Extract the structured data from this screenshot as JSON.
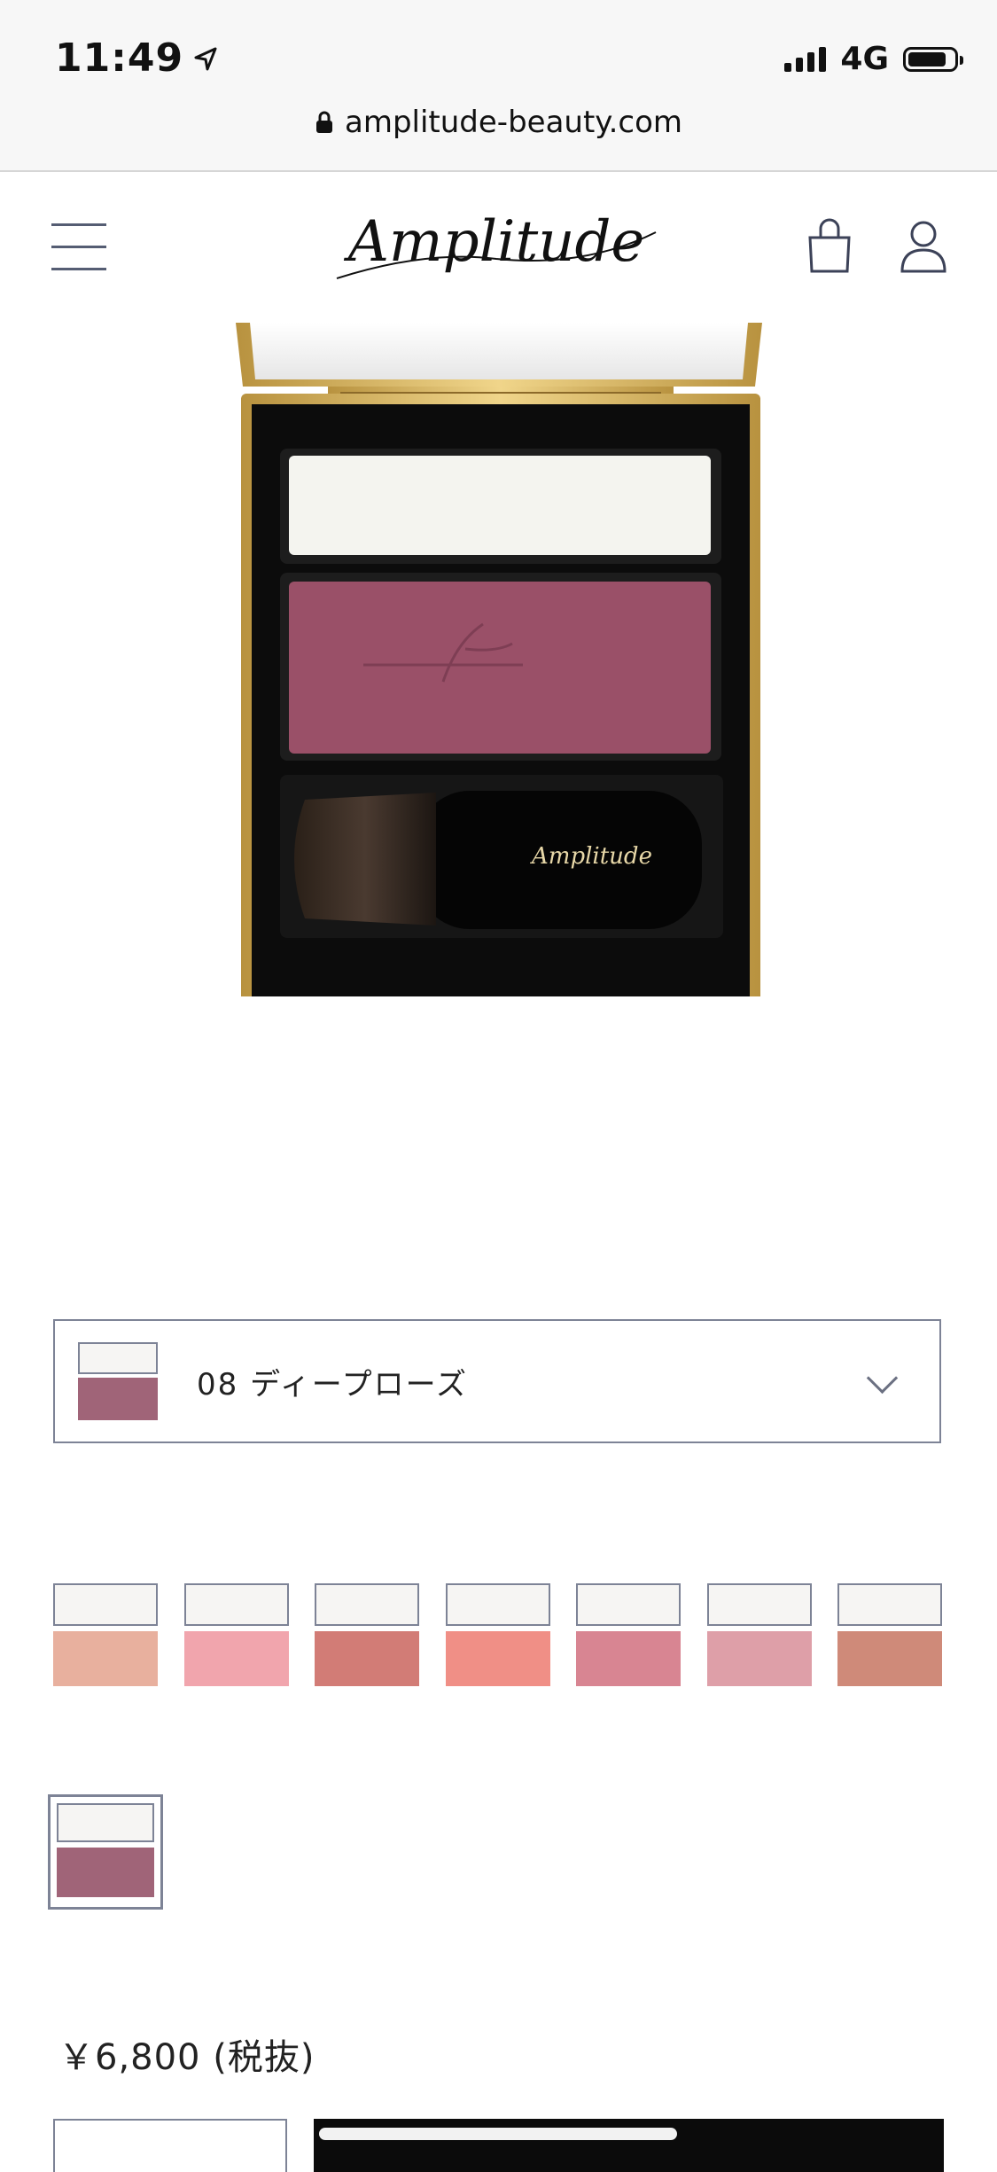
{
  "status_bar": {
    "time": "11:49",
    "network": "4G",
    "location_icon": "location-arrow-icon",
    "signal_icon": "cellular-signal-icon",
    "battery_icon": "battery-icon"
  },
  "browser": {
    "url": "amplitude-beauty.com",
    "lock_icon": "lock-icon"
  },
  "header": {
    "brand": "Amplitude",
    "menu_icon": "hamburger-menu-icon",
    "cart_icon": "shopping-bag-icon",
    "account_icon": "user-icon"
  },
  "product": {
    "compact_brand_text": "Amplitude",
    "image_icon": "blush-compact-image"
  },
  "shade_selector": {
    "selected_label": "08 ディープローズ",
    "selected_color": "#a06478",
    "chevron_icon": "chevron-down-icon"
  },
  "swatches": [
    {
      "color": "#e8b09e"
    },
    {
      "color": "#f1a5ad"
    },
    {
      "color": "#d27c76"
    },
    {
      "color": "#f08f86"
    },
    {
      "color": "#d88592"
    },
    {
      "color": "#de9fa8"
    },
    {
      "color": "#cf8a79"
    },
    {
      "color": "#a06478",
      "selected": true
    }
  ],
  "price": {
    "label": "￥6,800 (税抜)"
  },
  "colors": {
    "accent_border": "#7d8396",
    "gold": "#c9a24f",
    "button": "#0b0b0b"
  }
}
